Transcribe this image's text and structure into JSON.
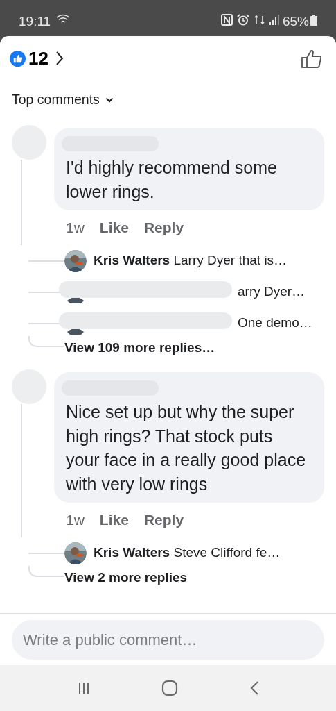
{
  "status_bar": {
    "time": "19:11",
    "battery": "65%"
  },
  "header": {
    "reaction_count": "12"
  },
  "sort": {
    "label": "Top comments"
  },
  "comments": [
    {
      "text": "I'd highly recommend some lower rings.",
      "time": "1w",
      "like": "Like",
      "reply": "Reply",
      "replies": [
        {
          "kind": "named",
          "author": "Kris Walters",
          "text": "Larry Dyer that is…"
        },
        {
          "kind": "redacted",
          "text": "arry Dyer…"
        },
        {
          "kind": "redacted",
          "text": "One demo…"
        }
      ],
      "more": "View 109 more replies…"
    },
    {
      "text": "Nice set up but why the super high rings? That stock puts your face in a really good place with very low rings",
      "time": "1w",
      "like": "Like",
      "reply": "Reply",
      "replies": [
        {
          "kind": "named",
          "author": "Kris Walters",
          "text": "Steve Clifford fe…"
        }
      ],
      "more": "View 2 more replies"
    }
  ],
  "composer": {
    "placeholder": "Write a public comment…"
  }
}
